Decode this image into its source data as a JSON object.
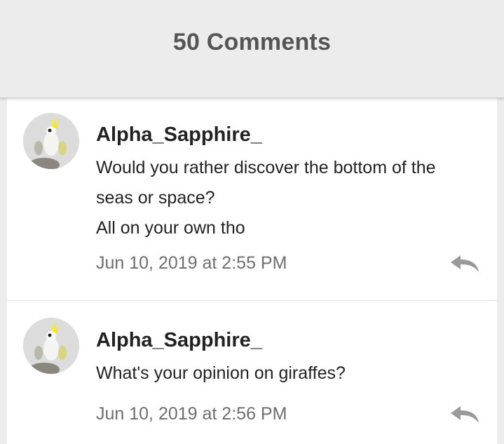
{
  "header": {
    "title": "50 Comments"
  },
  "comments": [
    {
      "username": "Alpha_Sapphire_",
      "lines": [
        "Would you rather discover the bottom of the",
        "seas or space?",
        "All on your own tho"
      ],
      "timestamp": "Jun 10, 2019 at 2:55 PM"
    },
    {
      "username": "Alpha_Sapphire_",
      "lines": [
        "What's your opinion on giraffes?"
      ],
      "timestamp": "Jun 10, 2019 at 2:56 PM"
    }
  ],
  "icons": {
    "reply": "reply-arrow-icon",
    "avatar": "cockatoo-avatar"
  },
  "colors": {
    "header_bg": "#ececec",
    "title": "#555555",
    "username": "#222222",
    "timestamp": "#6e6e6e",
    "reply_icon": "#9a9a9a"
  }
}
